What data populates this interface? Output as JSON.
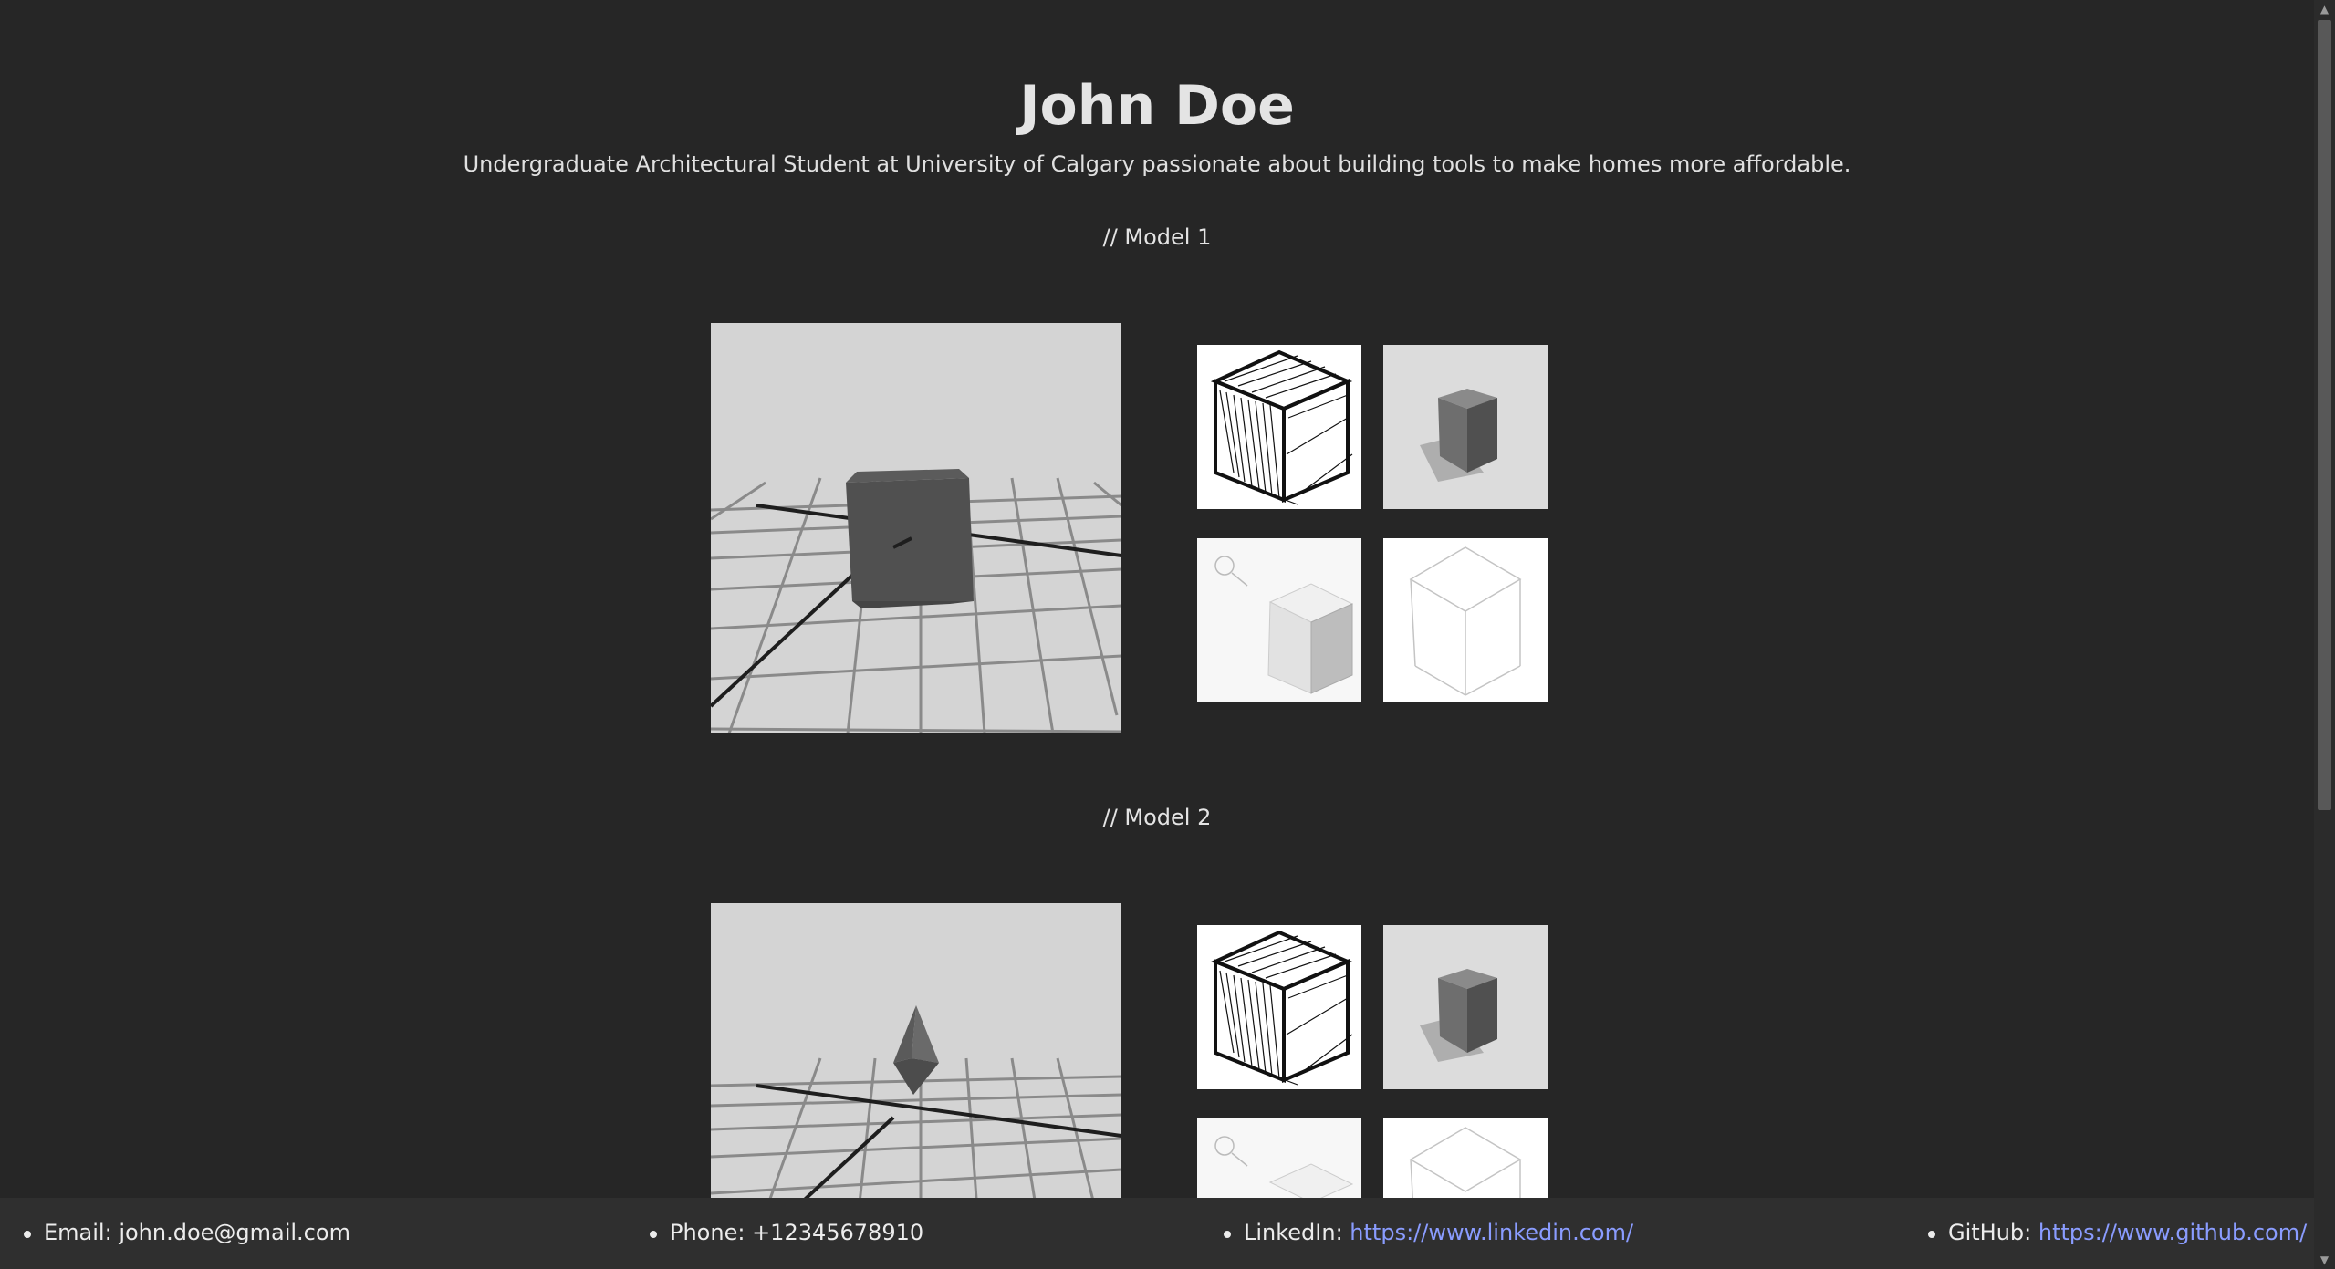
{
  "header": {
    "name": "John Doe",
    "tagline": "Undergraduate Architectural Student at University of Calgary passionate about building tools to make homes more affordable."
  },
  "models": [
    {
      "title": "// Model 1",
      "shape": "cube"
    },
    {
      "title": "// Model 2",
      "shape": "pyramid"
    }
  ],
  "footer": {
    "email_label": "Email: ",
    "email_value": "john.doe@gmail.com",
    "phone_label": "Phone: ",
    "phone_value": "+12345678910",
    "linkedin_label": "LinkedIn: ",
    "linkedin_url": "https://www.linkedin.com/",
    "github_label": "GitHub: ",
    "github_url": "https://www.github.com/"
  }
}
